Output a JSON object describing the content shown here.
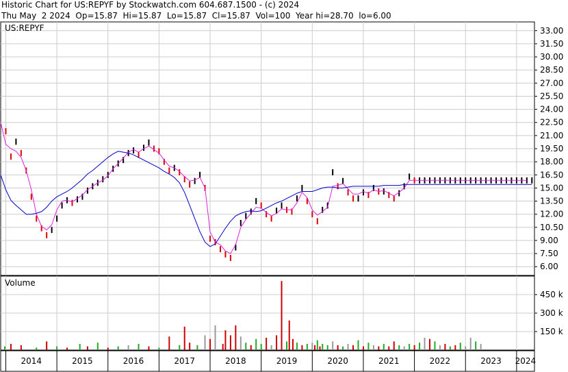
{
  "header": {
    "line1": "Historic Chart for US:REPYF by Stockwatch.com 604.687.1500 - (c) 2024",
    "line2": "Thu May  2 2024  Op=15.87  Hi=15.87  Lo=15.87  Cl=15.87  Vol=100  Year hi=28.70  lo=6.00"
  },
  "colors": {
    "price_up": "#000000",
    "price_down": "#dd0000",
    "ma_short": "#dd22dd",
    "ma_long": "#0000cc",
    "vol_up": "#22aa22",
    "vol_down": "#cc0000",
    "vol_neutral": "#999999",
    "grid": "#cccccc"
  },
  "chart_data": [
    {
      "type": "line",
      "title": "US:REPYF",
      "ylim": [
        5.0,
        34.0
      ],
      "y_ticks": [
        "33.00",
        "31.50",
        "30.00",
        "28.50",
        "27.00",
        "25.50",
        "24.00",
        "22.50",
        "21.00",
        "19.50",
        "18.00",
        "16.50",
        "15.00",
        "13.50",
        "12.00",
        "10.50",
        "9.00",
        "7.50",
        "6.00"
      ],
      "x_labels": [
        "2014",
        "2015",
        "2016",
        "2017",
        "2018",
        "2019",
        "2020",
        "2021",
        "2022",
        "2023",
        "2024"
      ],
      "x": [
        2013.5,
        2013.6,
        2013.7,
        2013.8,
        2013.9,
        2014.0,
        2014.1,
        2014.2,
        2014.3,
        2014.4,
        2014.5,
        2014.6,
        2014.7,
        2014.8,
        2014.9,
        2015.0,
        2015.1,
        2015.2,
        2015.3,
        2015.4,
        2015.5,
        2015.6,
        2015.7,
        2015.8,
        2015.9,
        2016.0,
        2016.1,
        2016.2,
        2016.3,
        2016.4,
        2016.5,
        2016.6,
        2016.7,
        2016.8,
        2016.9,
        2017.0,
        2017.1,
        2017.2,
        2017.3,
        2017.4,
        2017.5,
        2017.6,
        2017.7,
        2017.8,
        2017.9,
        2018.0,
        2018.1,
        2018.2,
        2018.3,
        2018.4,
        2018.5,
        2018.6,
        2018.7,
        2018.8,
        2018.9,
        2019.0,
        2019.1,
        2019.2,
        2019.3,
        2019.4,
        2019.5,
        2019.6,
        2019.7,
        2019.8,
        2019.9,
        2020.0,
        2020.1,
        2020.2,
        2020.3,
        2020.4,
        2020.5,
        2020.6,
        2020.7,
        2020.8,
        2020.9,
        2021.0,
        2021.1,
        2021.2,
        2021.3,
        2021.4,
        2021.5,
        2021.6,
        2021.7,
        2021.8,
        2021.9,
        2022.0,
        2022.1,
        2022.2,
        2022.3,
        2022.4,
        2022.5,
        2022.6,
        2022.7,
        2022.8,
        2022.9,
        2023.0,
        2023.1,
        2023.2,
        2023.3,
        2023.4,
        2023.5,
        2023.6,
        2023.7,
        2023.8,
        2023.9,
        2024.0,
        2024.1,
        2024.2,
        2024.3
      ],
      "series": [
        {
          "role": "price",
          "values": [
            28.2,
            26.8,
            25.2,
            24.6,
            23.4,
            21.5,
            18.6,
            20.3,
            19.0,
            17.0,
            14.0,
            11.5,
            10.4,
            9.6,
            10.2,
            11.5,
            13.0,
            13.6,
            13.3,
            13.7,
            14.0,
            14.7,
            15.2,
            15.6,
            16.0,
            16.5,
            17.2,
            17.8,
            18.2,
            19.0,
            19.3,
            18.8,
            19.6,
            20.2,
            19.5,
            19.2,
            18.0,
            17.0,
            17.3,
            16.8,
            16.0,
            15.4,
            15.8,
            16.5,
            15.0,
            9.2,
            8.8,
            8.0,
            7.4,
            7.0,
            8.2,
            11.0,
            11.8,
            12.3,
            13.5,
            13.0,
            12.0,
            11.5,
            12.4,
            13.0,
            12.5,
            12.3,
            13.8,
            15.0,
            13.5,
            12.0,
            11.2,
            12.5,
            13.0,
            16.8,
            15.2,
            15.8,
            14.5,
            13.8,
            13.8,
            14.5,
            14.2,
            15.0,
            14.6,
            14.6,
            14.2,
            13.8,
            14.4,
            15.2,
            16.3,
            15.87,
            15.87,
            15.87,
            15.87,
            15.87,
            15.87,
            15.87,
            15.87,
            15.87,
            15.87,
            15.87,
            15.87,
            15.87,
            15.87,
            15.87,
            15.87,
            15.87,
            15.87,
            15.87,
            15.87,
            15.87,
            15.87,
            15.87,
            15.87
          ]
        },
        {
          "role": "ma_short",
          "values": [
            27.5,
            26.0,
            25.0,
            23.8,
            22.5,
            20.0,
            19.5,
            19.2,
            18.5,
            17.0,
            14.8,
            12.0,
            10.6,
            10.2,
            10.8,
            12.5,
            13.5,
            13.6,
            13.4,
            13.8,
            14.2,
            14.8,
            15.2,
            15.6,
            15.9,
            16.4,
            17.2,
            17.8,
            18.4,
            19.1,
            19.4,
            19.1,
            19.5,
            19.8,
            19.4,
            19.0,
            18.2,
            17.5,
            17.3,
            16.9,
            16.3,
            15.8,
            15.9,
            16.2,
            15.0,
            10.0,
            8.8,
            8.5,
            7.8,
            7.5,
            8.5,
            10.5,
            11.4,
            12.1,
            12.8,
            12.7,
            12.2,
            11.8,
            12.1,
            12.6,
            12.5,
            12.5,
            13.3,
            14.5,
            13.9,
            12.5,
            11.9,
            12.3,
            12.8,
            15.2,
            15.3,
            15.5,
            14.9,
            14.3,
            14.3,
            14.6,
            14.4,
            14.8,
            14.6,
            14.7,
            14.4,
            14.1,
            14.5,
            15.0,
            15.87,
            15.87,
            15.87,
            15.87,
            15.87,
            15.87,
            15.87,
            15.87,
            15.87,
            15.87,
            15.87,
            15.87,
            15.87,
            15.87,
            15.87,
            15.87,
            15.87,
            15.87,
            15.87,
            15.87,
            15.87,
            15.87,
            15.87,
            15.87
          ]
        },
        {
          "role": "ma_long",
          "values": [
            22.8,
            21.5,
            20.0,
            18.3,
            16.5,
            14.8,
            13.6,
            13.0,
            12.5,
            12.0,
            12.0,
            12.1,
            12.3,
            12.8,
            13.5,
            14.0,
            14.3,
            14.6,
            15.0,
            15.5,
            16.0,
            16.6,
            17.0,
            17.5,
            18.0,
            18.5,
            18.9,
            19.2,
            19.1,
            19.0,
            18.8,
            18.5,
            18.2,
            17.9,
            17.6,
            17.3,
            16.9,
            16.6,
            16.2,
            15.6,
            14.5,
            13.0,
            11.5,
            10.0,
            8.8,
            8.3,
            8.6,
            9.5,
            10.4,
            11.2,
            11.8,
            12.1,
            12.3,
            12.4,
            12.3,
            12.4,
            12.7,
            13.0,
            13.3,
            13.5,
            13.8,
            14.1,
            14.4,
            14.6,
            14.6,
            14.6,
            14.8,
            15.0,
            15.1,
            15.1,
            15.0,
            15.0,
            15.1,
            15.2,
            15.2,
            15.2,
            15.2,
            15.2,
            15.2,
            15.3,
            15.3,
            15.3,
            15.3,
            15.4,
            15.4,
            15.4,
            15.4,
            15.4,
            15.4,
            15.4,
            15.4,
            15.4,
            15.4,
            15.4,
            15.4,
            15.4,
            15.4,
            15.4,
            15.4,
            15.4,
            15.4,
            15.4,
            15.4,
            15.4,
            15.4,
            15.4,
            15.4,
            15.4,
            15.4
          ]
        }
      ]
    },
    {
      "type": "bar",
      "title": "Volume",
      "ylim": [
        0,
        600000
      ],
      "y_ticks": [
        "450 k",
        "300 k",
        "150 k"
      ],
      "y_tick_values": [
        450000,
        300000,
        150000
      ],
      "x": [
        2013.52,
        2013.58,
        2013.66,
        2013.75,
        2013.82,
        2013.9,
        2013.98,
        2014.1,
        2014.3,
        2014.6,
        2014.8,
        2015.0,
        2015.2,
        2015.45,
        2015.6,
        2015.8,
        2016.0,
        2016.2,
        2016.4,
        2016.6,
        2016.8,
        2017.0,
        2017.2,
        2017.4,
        2017.5,
        2017.6,
        2017.75,
        2017.9,
        2018.0,
        2018.1,
        2018.25,
        2018.3,
        2018.4,
        2018.5,
        2018.6,
        2018.7,
        2018.8,
        2018.9,
        2019.0,
        2019.1,
        2019.2,
        2019.3,
        2019.4,
        2019.5,
        2019.55,
        2019.62,
        2019.7,
        2019.8,
        2019.9,
        2020.0,
        2020.05,
        2020.1,
        2020.15,
        2020.2,
        2020.3,
        2020.4,
        2020.5,
        2020.6,
        2020.7,
        2020.8,
        2020.9,
        2021.0,
        2021.1,
        2021.2,
        2021.3,
        2021.4,
        2021.5,
        2021.6,
        2021.7,
        2021.8,
        2021.9,
        2022.0,
        2022.1,
        2022.2,
        2022.3,
        2022.4,
        2022.5,
        2022.6,
        2022.7,
        2022.8,
        2022.9,
        2023.0,
        2023.1,
        2023.2,
        2023.3
      ],
      "values": [
        150000,
        60000,
        80000,
        40000,
        110000,
        90000,
        30000,
        50000,
        40000,
        20000,
        70000,
        30000,
        20000,
        50000,
        30000,
        60000,
        20000,
        30000,
        40000,
        50000,
        30000,
        20000,
        110000,
        40000,
        190000,
        60000,
        40000,
        120000,
        90000,
        200000,
        50000,
        160000,
        120000,
        200000,
        110000,
        60000,
        40000,
        90000,
        50000,
        100000,
        40000,
        120000,
        560000,
        70000,
        240000,
        90000,
        60000,
        40000,
        50000,
        60000,
        40000,
        80000,
        30000,
        50000,
        40000,
        70000,
        40000,
        30000,
        50000,
        40000,
        80000,
        30000,
        60000,
        40000,
        30000,
        50000,
        30000,
        70000,
        40000,
        30000,
        50000,
        40000,
        60000,
        100000,
        90000,
        70000,
        40000,
        50000,
        30000,
        40000,
        60000,
        30000,
        100000,
        70000,
        50000
      ],
      "colors": [
        "down",
        "down",
        "down",
        "up",
        "up",
        "down",
        "up",
        "down",
        "down",
        "up",
        "down",
        "up",
        "down",
        "up",
        "down",
        "up",
        "down",
        "up",
        "neutral",
        "up",
        "down",
        "up",
        "down",
        "up",
        "down",
        "down",
        "up",
        "neutral",
        "down",
        "neutral",
        "down",
        "down",
        "down",
        "down",
        "neutral",
        "up",
        "down",
        "up",
        "up",
        "down",
        "neutral",
        "down",
        "down",
        "up",
        "down",
        "down",
        "up",
        "down",
        "up",
        "neutral",
        "down",
        "up",
        "down",
        "up",
        "up",
        "neutral",
        "down",
        "up",
        "neutral",
        "down",
        "up",
        "down",
        "up",
        "neutral",
        "down",
        "up",
        "down",
        "down",
        "up",
        "neutral",
        "up",
        "down",
        "up",
        "neutral",
        "down",
        "up",
        "neutral",
        "down",
        "up",
        "down",
        "up",
        "neutral",
        "neutral",
        "up",
        "neutral"
      ]
    }
  ]
}
